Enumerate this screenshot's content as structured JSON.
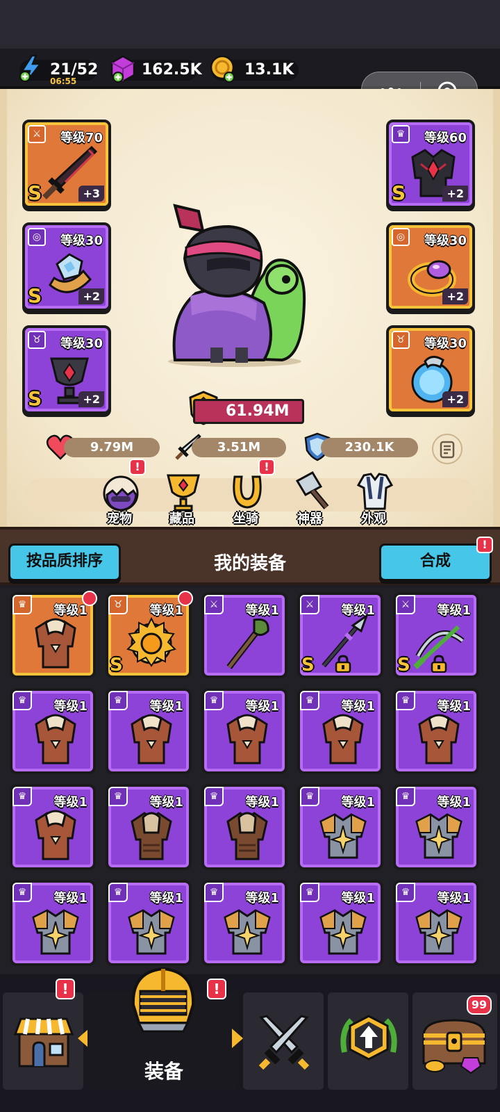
{
  "resources": {
    "energy": "21/52",
    "energy_timer": "06:55",
    "gems": "162.5K",
    "gold": "13.1K"
  },
  "equipped": {
    "left": [
      {
        "level": "等级70",
        "plus": "+3",
        "grade": "S",
        "frame": "orange",
        "item": "sword-icon"
      },
      {
        "level": "等级30",
        "plus": "+2",
        "grade": "S",
        "frame": "purple",
        "item": "bracer-icon"
      },
      {
        "level": "等级30",
        "plus": "+2",
        "grade": "S",
        "frame": "purple",
        "item": "chalice-icon"
      }
    ],
    "right": [
      {
        "level": "等级60",
        "plus": "+2",
        "grade": "S",
        "frame": "purple",
        "item": "armor-icon"
      },
      {
        "level": "等级30",
        "plus": "+2",
        "grade": "",
        "frame": "orange",
        "item": "ring-icon"
      },
      {
        "level": "等级30",
        "plus": "+2",
        "grade": "",
        "frame": "orange",
        "item": "orb-icon"
      }
    ]
  },
  "power": "61.94M",
  "stats": {
    "hp": "9.79M",
    "attack": "3.51M",
    "defense": "230.1K"
  },
  "feature_tabs": [
    {
      "label": "宠物",
      "badge": "!"
    },
    {
      "label": "藏品",
      "badge": ""
    },
    {
      "label": "坐骑",
      "badge": "!"
    },
    {
      "label": "神器",
      "badge": ""
    },
    {
      "label": "外观",
      "badge": ""
    }
  ],
  "bag": {
    "sort_button": "按品质排序",
    "title": "我的装备",
    "synth_button": "合成",
    "synth_badge": "!"
  },
  "items": [
    {
      "level": "等级1",
      "frame": "orange",
      "grade": "",
      "art": "leather-armor",
      "new": true,
      "locked": false
    },
    {
      "level": "等级1",
      "frame": "orange",
      "grade": "S",
      "art": "amulet",
      "new": true,
      "locked": false
    },
    {
      "level": "等级1",
      "frame": "purple",
      "grade": "",
      "art": "staff",
      "new": false,
      "locked": false
    },
    {
      "level": "等级1",
      "frame": "purple",
      "grade": "S",
      "art": "spear",
      "new": false,
      "locked": true
    },
    {
      "level": "等级1",
      "frame": "purple",
      "grade": "S",
      "art": "crossbow",
      "new": false,
      "locked": true
    },
    {
      "level": "等级1",
      "frame": "purple",
      "grade": "",
      "art": "leather-armor",
      "new": false,
      "locked": false
    },
    {
      "level": "等级1",
      "frame": "purple",
      "grade": "",
      "art": "leather-armor",
      "new": false,
      "locked": false
    },
    {
      "level": "等级1",
      "frame": "purple",
      "grade": "",
      "art": "leather-armor",
      "new": false,
      "locked": false
    },
    {
      "level": "等级1",
      "frame": "purple",
      "grade": "",
      "art": "leather-armor",
      "new": false,
      "locked": false
    },
    {
      "level": "等级1",
      "frame": "purple",
      "grade": "",
      "art": "leather-armor",
      "new": false,
      "locked": false
    },
    {
      "level": "等级1",
      "frame": "purple",
      "grade": "",
      "art": "leather-armor",
      "new": false,
      "locked": false
    },
    {
      "level": "等级1",
      "frame": "purple",
      "grade": "",
      "art": "fur-armor",
      "new": false,
      "locked": false
    },
    {
      "level": "等级1",
      "frame": "purple",
      "grade": "",
      "art": "fur-armor",
      "new": false,
      "locked": false
    },
    {
      "level": "等级1",
      "frame": "purple",
      "grade": "",
      "art": "plate-armor",
      "new": false,
      "locked": false
    },
    {
      "level": "等级1",
      "frame": "purple",
      "grade": "",
      "art": "plate-armor",
      "new": false,
      "locked": false
    },
    {
      "level": "等级1",
      "frame": "purple",
      "grade": "",
      "art": "plate-armor",
      "new": false,
      "locked": false
    },
    {
      "level": "等级1",
      "frame": "purple",
      "grade": "",
      "art": "plate-armor",
      "new": false,
      "locked": false
    },
    {
      "level": "等级1",
      "frame": "purple",
      "grade": "",
      "art": "plate-armor",
      "new": false,
      "locked": false
    },
    {
      "level": "等级1",
      "frame": "purple",
      "grade": "",
      "art": "plate-armor",
      "new": false,
      "locked": false
    },
    {
      "level": "等级1",
      "frame": "purple",
      "grade": "",
      "art": "plate-armor",
      "new": false,
      "locked": false
    }
  ],
  "bottom_nav": {
    "shop_badge": "!",
    "equip_label": "装备",
    "equip_badge": "!",
    "chest_badge": "99"
  },
  "colors": {
    "purple_frame": "#8d43d8",
    "orange_frame": "#e0783a",
    "button_cyan": "#46c6e8",
    "badge_red": "#e8324a",
    "power_banner": "#b8325a"
  }
}
